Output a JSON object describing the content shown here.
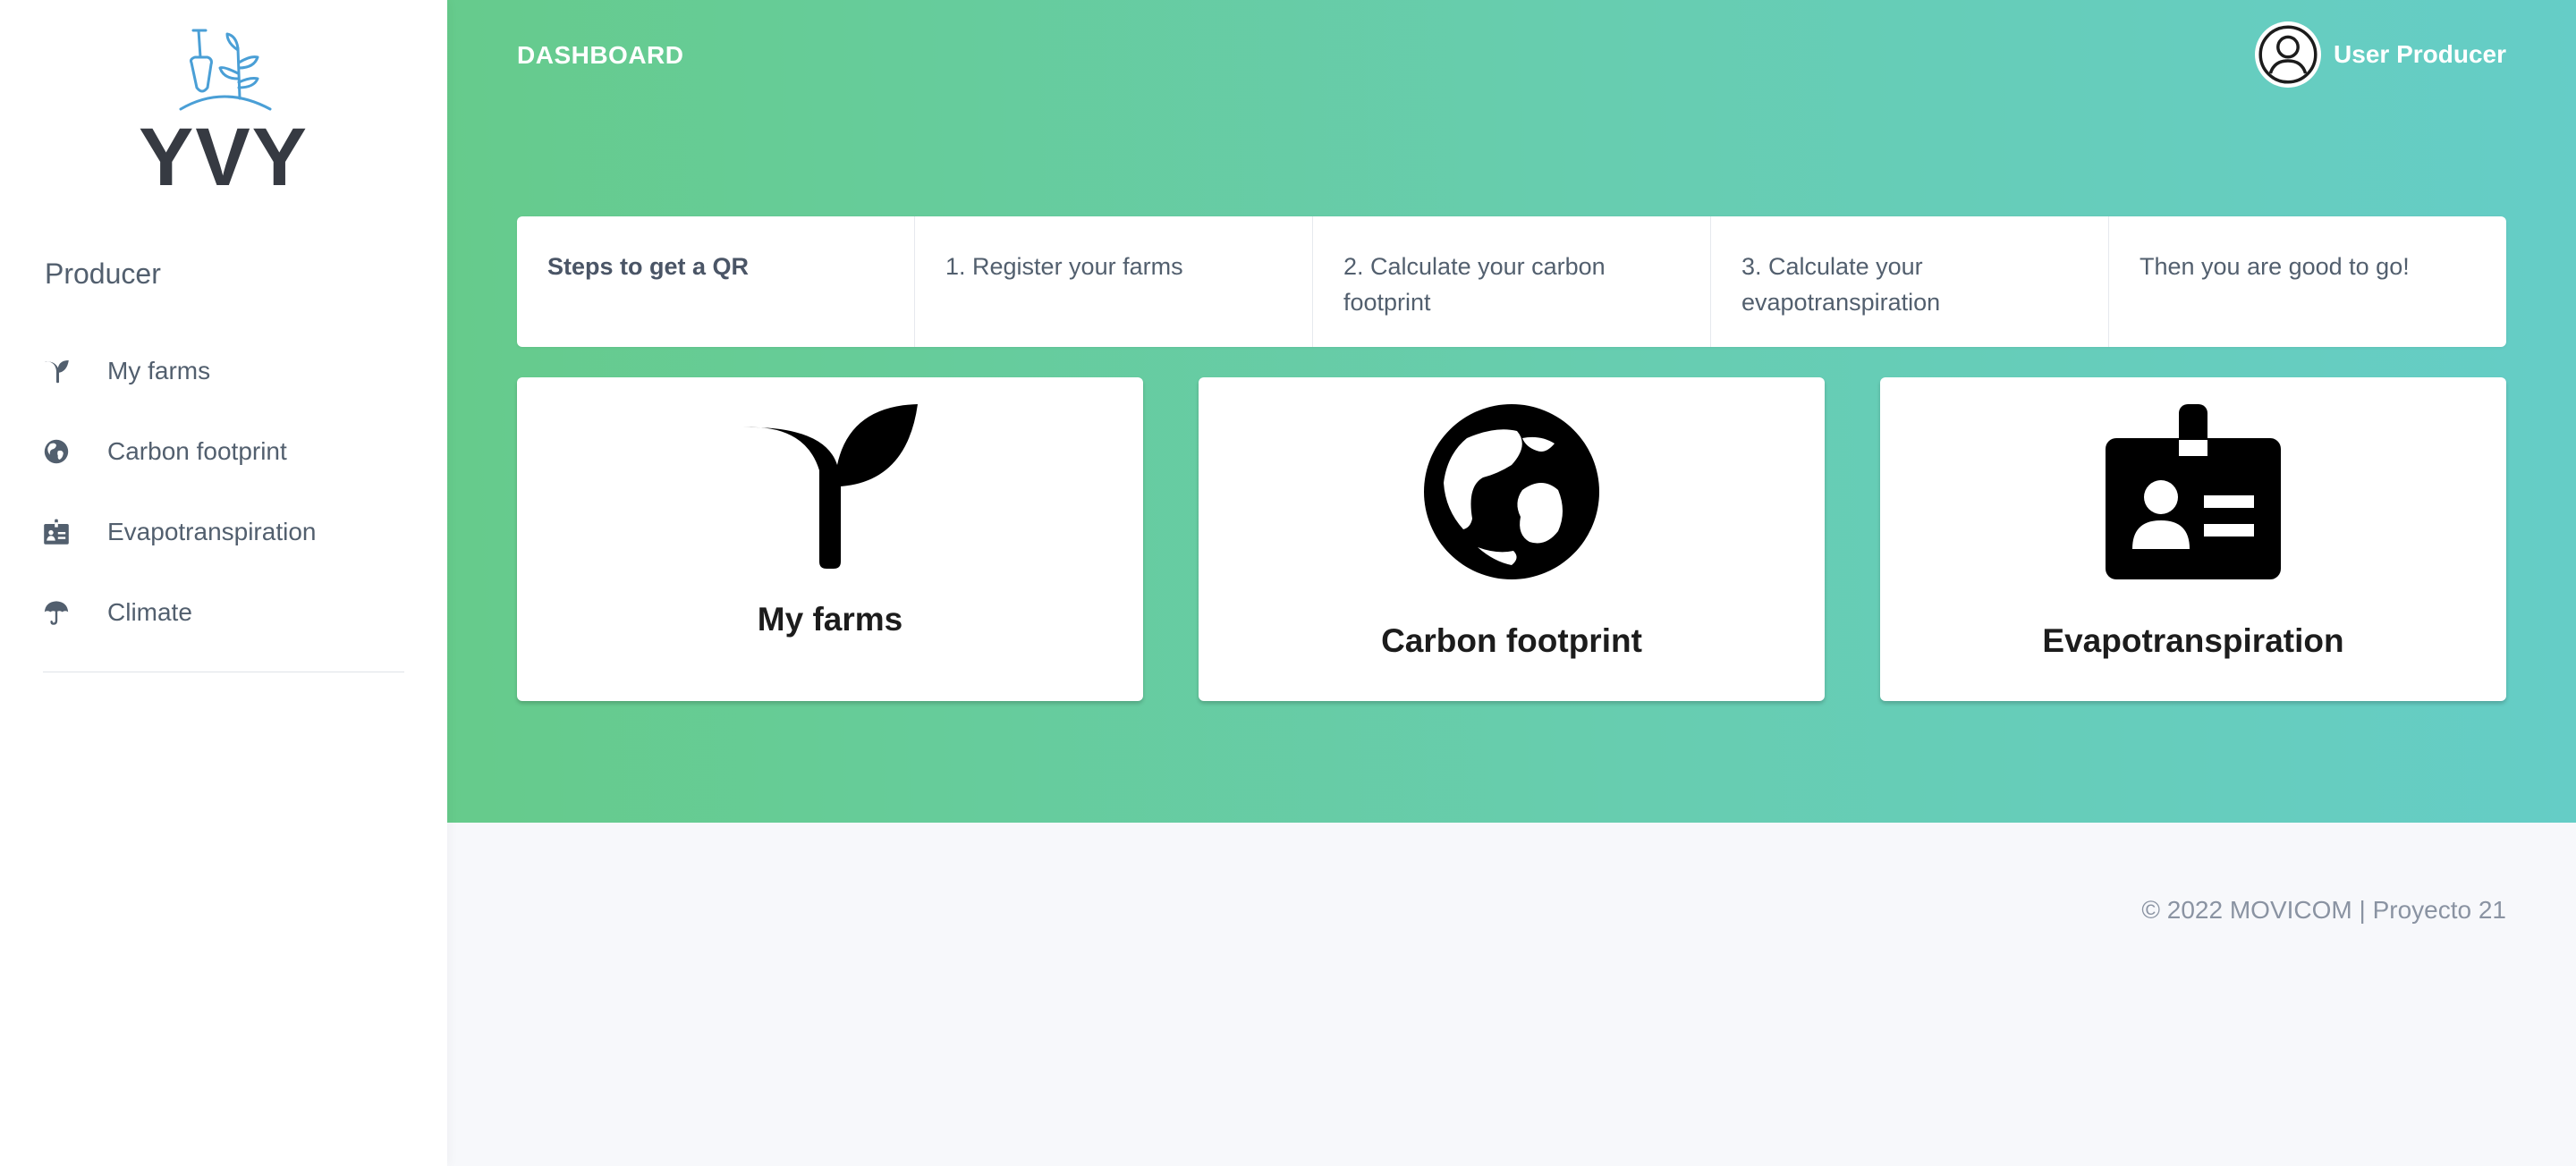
{
  "logo": {
    "text": "YVY"
  },
  "sidebar": {
    "section_title": "Producer",
    "items": [
      {
        "label": "My farms",
        "icon": "seedling-icon"
      },
      {
        "label": "Carbon footprint",
        "icon": "globe-icon"
      },
      {
        "label": "Evapotranspiration",
        "icon": "id-badge-icon"
      },
      {
        "label": "Climate",
        "icon": "umbrella-icon"
      }
    ]
  },
  "header": {
    "title": "DASHBOARD",
    "user_name": "User Producer"
  },
  "steps": [
    "Steps to get a QR",
    "1. Register your farms",
    "2. Calculate your carbon footprint",
    "3. Calculate your evapotranspiration",
    "Then you are good to go!"
  ],
  "cards": [
    {
      "label": "My farms",
      "icon": "seedling-icon"
    },
    {
      "label": "Carbon footprint",
      "icon": "globe-icon"
    },
    {
      "label": "Evapotranspiration",
      "icon": "id-badge-icon"
    }
  ],
  "footer": {
    "text": "© 2022 MOVICOM | Proyecto 21"
  },
  "colors": {
    "gradient_start": "#66cb8b",
    "gradient_end": "#65cdc7",
    "sidebar_text": "#525f6e",
    "logo_line": "#4a9fd6"
  }
}
